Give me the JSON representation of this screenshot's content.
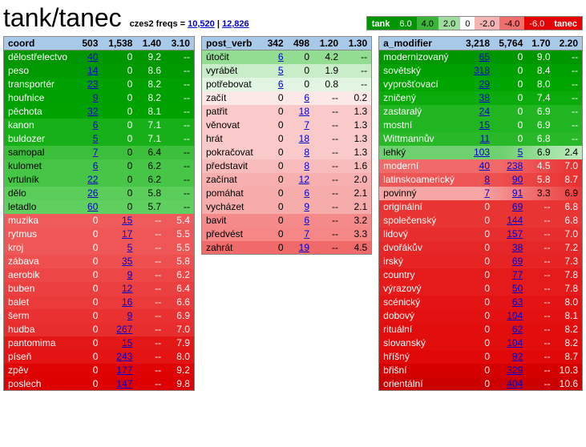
{
  "title": "tank/tanec",
  "freqs_label": "czes2 freqs =",
  "freq1": "10,520",
  "freq2": "12,826",
  "legend": {
    "left": "tank",
    "right": "tanec",
    "vals": [
      "6.0",
      "4.0",
      "2.0",
      "0",
      "-2.0",
      "-4.0",
      "-6.0"
    ]
  },
  "chart_data": [
    {
      "type": "table",
      "name": "coord",
      "header_nums": [
        "503",
        "1,538",
        "1.40",
        "3.10"
      ],
      "rows": [
        {
          "w": "dělostřelectvo",
          "a": "40",
          "b": "0",
          "c": "9.2",
          "d": "--",
          "cls": "g90"
        },
        {
          "w": "peso",
          "a": "14",
          "b": "0",
          "c": "8.6",
          "d": "--",
          "cls": "g86"
        },
        {
          "w": "transportér",
          "a": "23",
          "b": "0",
          "c": "8.2",
          "d": "--",
          "cls": "g82"
        },
        {
          "w": "houfnice",
          "a": "9",
          "b": "0",
          "c": "8.2",
          "d": "--",
          "cls": "g82"
        },
        {
          "w": "pěchota",
          "a": "32",
          "b": "0",
          "c": "8.1",
          "d": "--",
          "cls": "g81"
        },
        {
          "w": "kanon",
          "a": "6",
          "b": "0",
          "c": "7.1",
          "d": "--",
          "cls": "g71"
        },
        {
          "w": "buldozer",
          "a": "5",
          "b": "0",
          "c": "7.1",
          "d": "--",
          "cls": "g71"
        },
        {
          "w": "samopal",
          "a": "7",
          "b": "0",
          "c": "6.4",
          "d": "--",
          "cls": "g64"
        },
        {
          "w": "kulomet",
          "a": "6",
          "b": "0",
          "c": "6.2",
          "d": "--",
          "cls": "g62"
        },
        {
          "w": "vrtulník",
          "a": "22",
          "b": "0",
          "c": "6.2",
          "d": "--",
          "cls": "g62"
        },
        {
          "w": "dělo",
          "a": "26",
          "b": "0",
          "c": "5.8",
          "d": "--",
          "cls": "g58"
        },
        {
          "w": "letadlo",
          "a": "60",
          "b": "0",
          "c": "5.7",
          "d": "--",
          "cls": "g57"
        },
        {
          "w": "muzika",
          "a": "0",
          "b": "15",
          "c": "--",
          "d": "5.4",
          "cls": "r54"
        },
        {
          "w": "rytmus",
          "a": "0",
          "b": "17",
          "c": "--",
          "d": "5.5",
          "cls": "r55"
        },
        {
          "w": "kroj",
          "a": "0",
          "b": "5",
          "c": "--",
          "d": "5.5",
          "cls": "r55"
        },
        {
          "w": "zábava",
          "a": "0",
          "b": "35",
          "c": "--",
          "d": "5.8",
          "cls": "r58"
        },
        {
          "w": "aerobik",
          "a": "0",
          "b": "9",
          "c": "--",
          "d": "6.2",
          "cls": "r62"
        },
        {
          "w": "buben",
          "a": "0",
          "b": "12",
          "c": "--",
          "d": "6.4",
          "cls": "r64"
        },
        {
          "w": "balet",
          "a": "0",
          "b": "16",
          "c": "--",
          "d": "6.6",
          "cls": "r66"
        },
        {
          "w": "šerm",
          "a": "0",
          "b": "9",
          "c": "--",
          "d": "6.9",
          "cls": "r69"
        },
        {
          "w": "hudba",
          "a": "0",
          "b": "267",
          "c": "--",
          "d": "7.0",
          "cls": "r70"
        },
        {
          "w": "pantomima",
          "a": "0",
          "b": "15",
          "c": "--",
          "d": "7.9",
          "cls": "r79"
        },
        {
          "w": "píseň",
          "a": "0",
          "b": "243",
          "c": "--",
          "d": "8.0",
          "cls": "r80"
        },
        {
          "w": "zpěv",
          "a": "0",
          "b": "177",
          "c": "--",
          "d": "9.2",
          "cls": "r92"
        },
        {
          "w": "poslech",
          "a": "0",
          "b": "147",
          "c": "--",
          "d": "9.8",
          "cls": "r98"
        }
      ]
    },
    {
      "type": "table",
      "name": "post_verb",
      "header_nums": [
        "342",
        "498",
        "1.20",
        "1.30"
      ],
      "rows": [
        {
          "w": "útočit",
          "a": "6",
          "b": "0",
          "c": "4.2",
          "d": "--",
          "cls": "g42"
        },
        {
          "w": "vyrábět",
          "a": "5",
          "b": "0",
          "c": "1.9",
          "d": "--",
          "cls": "g19"
        },
        {
          "w": "potřebovat",
          "a": "6",
          "b": "0",
          "c": "0.8",
          "d": "--",
          "cls": "g08"
        },
        {
          "w": "začít",
          "a": "0",
          "b": "6",
          "c": "--",
          "d": "0.2",
          "cls": "r02"
        },
        {
          "w": "patřit",
          "a": "0",
          "b": "18",
          "c": "--",
          "d": "1.3",
          "cls": "r13"
        },
        {
          "w": "věnovat",
          "a": "0",
          "b": "7",
          "c": "--",
          "d": "1.3",
          "cls": "r13"
        },
        {
          "w": "hrát",
          "a": "0",
          "b": "18",
          "c": "--",
          "d": "1.3",
          "cls": "r13"
        },
        {
          "w": "pokračovat",
          "a": "0",
          "b": "8",
          "c": "--",
          "d": "1.3",
          "cls": "r13"
        },
        {
          "w": "představit",
          "a": "0",
          "b": "8",
          "c": "--",
          "d": "1.6",
          "cls": "r16"
        },
        {
          "w": "začínat",
          "a": "0",
          "b": "12",
          "c": "--",
          "d": "2.0",
          "cls": "r20"
        },
        {
          "w": "pomáhat",
          "a": "0",
          "b": "6",
          "c": "--",
          "d": "2.1",
          "cls": "r21"
        },
        {
          "w": "vycházet",
          "a": "0",
          "b": "9",
          "c": "--",
          "d": "2.1",
          "cls": "r21"
        },
        {
          "w": "bavit",
          "a": "0",
          "b": "6",
          "c": "--",
          "d": "3.2",
          "cls": "r32"
        },
        {
          "w": "předvést",
          "a": "0",
          "b": "7",
          "c": "--",
          "d": "3.3",
          "cls": "r33"
        },
        {
          "w": "zahrát",
          "a": "0",
          "b": "19",
          "c": "--",
          "d": "4.5",
          "cls": "r45"
        }
      ]
    },
    {
      "type": "table",
      "name": "a_modifier",
      "header_nums": [
        "3,218",
        "5,764",
        "1.70",
        "2.20"
      ],
      "rows": [
        {
          "w": "modernizovaný",
          "a": "65",
          "b": "0",
          "c": "9.0",
          "d": "--",
          "cls": "g90"
        },
        {
          "w": "sovětský",
          "a": "318",
          "b": "0",
          "c": "8.4",
          "d": "--",
          "cls": "g82"
        },
        {
          "w": "vyprošťovací",
          "a": "29",
          "b": "0",
          "c": "8.0",
          "d": "--",
          "cls": "g80"
        },
        {
          "w": "zničený",
          "a": "38",
          "b": "0",
          "c": "7.4",
          "d": "--",
          "cls": "g74"
        },
        {
          "w": "zastaralý",
          "a": "24",
          "b": "0",
          "c": "6.9",
          "d": "--",
          "cls": "g69"
        },
        {
          "w": "mostní",
          "a": "15",
          "b": "0",
          "c": "6.9",
          "d": "--",
          "cls": "g69"
        },
        {
          "w": "Wittmannův",
          "a": "11",
          "b": "0",
          "c": "6.8",
          "d": "--",
          "cls": "g68"
        },
        {
          "w": "lehký",
          "a": "103",
          "b": "5",
          "c": "6.9",
          "d": "2.4",
          "cls": "gmix"
        },
        {
          "w": "moderní",
          "a": "40",
          "b": "238",
          "c": "4.5",
          "d": "7.0",
          "cls": "rmix1"
        },
        {
          "w": "latinskoamerický",
          "a": "8",
          "b": "90",
          "c": "5.8",
          "d": "8.7",
          "cls": "rmix2"
        },
        {
          "w": "povinný",
          "a": "7",
          "b": "91",
          "c": "3.3",
          "d": "6.9",
          "cls": "rmix3"
        },
        {
          "w": "originální",
          "a": "0",
          "b": "69",
          "c": "--",
          "d": "6.8",
          "cls": "r68"
        },
        {
          "w": "společenský",
          "a": "0",
          "b": "144",
          "c": "--",
          "d": "6.8",
          "cls": "r68"
        },
        {
          "w": "lidový",
          "a": "0",
          "b": "157",
          "c": "--",
          "d": "7.0",
          "cls": "r70"
        },
        {
          "w": "dvořákův",
          "a": "0",
          "b": "38",
          "c": "--",
          "d": "7.2",
          "cls": "r72"
        },
        {
          "w": "irský",
          "a": "0",
          "b": "69",
          "c": "--",
          "d": "7.3",
          "cls": "r73"
        },
        {
          "w": "country",
          "a": "0",
          "b": "77",
          "c": "--",
          "d": "7.8",
          "cls": "r78"
        },
        {
          "w": "výrazový",
          "a": "0",
          "b": "50",
          "c": "--",
          "d": "7.8",
          "cls": "r78"
        },
        {
          "w": "scénický",
          "a": "0",
          "b": "63",
          "c": "--",
          "d": "8.0",
          "cls": "r80"
        },
        {
          "w": "dobový",
          "a": "0",
          "b": "104",
          "c": "--",
          "d": "8.1",
          "cls": "r81"
        },
        {
          "w": "rituální",
          "a": "0",
          "b": "62",
          "c": "--",
          "d": "8.2",
          "cls": "r82"
        },
        {
          "w": "slovanský",
          "a": "0",
          "b": "104",
          "c": "--",
          "d": "8.2",
          "cls": "r82"
        },
        {
          "w": "hříšný",
          "a": "0",
          "b": "92",
          "c": "--",
          "d": "8.7",
          "cls": "r87"
        },
        {
          "w": "břišní",
          "a": "0",
          "b": "329",
          "c": "--",
          "d": "10.3",
          "cls": "r103"
        },
        {
          "w": "orientální",
          "a": "0",
          "b": "404",
          "c": "--",
          "d": "10.6",
          "cls": "r106"
        }
      ]
    }
  ]
}
